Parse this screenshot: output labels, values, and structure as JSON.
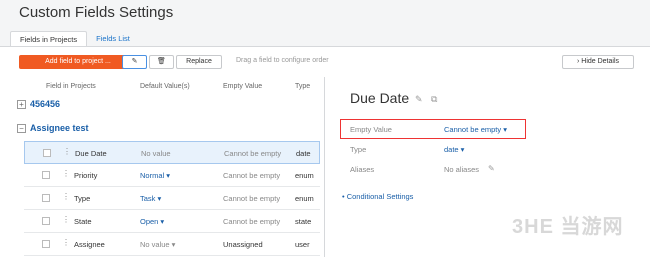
{
  "page": {
    "title": "Custom Fields Settings"
  },
  "tabs": [
    {
      "label": "Fields in Projects"
    },
    {
      "label": "Fields List"
    }
  ],
  "toolbar": {
    "add_label": "Add field to project ...",
    "replace_label": "Replace",
    "drag_hint": "Drag a field to configure order",
    "hide_label": "Hide Details",
    "pencil_icon": "✎",
    "trash_icon": "🗑"
  },
  "table": {
    "headers": {
      "field": "Field in Projects",
      "default": "Default Value(s)",
      "empty": "Empty Value",
      "type": "Type"
    },
    "groups": [
      {
        "name": "456456",
        "toggle": "+"
      },
      {
        "name": "Assignee test",
        "toggle": "−"
      }
    ],
    "rows": [
      {
        "name": "Due Date",
        "default": "No value",
        "empty": "Cannot be empty",
        "type": "date"
      },
      {
        "name": "Priority",
        "default": "Normal ▾",
        "empty": "Cannot be empty",
        "type": "enum"
      },
      {
        "name": "Type",
        "default": "Task ▾",
        "empty": "Cannot be empty",
        "type": "enum"
      },
      {
        "name": "State",
        "default": "Open ▾",
        "empty": "Cannot be empty",
        "type": "state"
      },
      {
        "name": "Assignee",
        "default": "No value ▾",
        "empty": "Unassigned",
        "type": "user"
      }
    ]
  },
  "details": {
    "title": "Due Date",
    "props": [
      {
        "label": "Empty Value",
        "value": "Cannot be empty ▾"
      },
      {
        "label": "Type",
        "value": "date ▾"
      },
      {
        "label": "Aliases",
        "value": "No aliases"
      }
    ],
    "conditional": "Conditional Settings",
    "edit_icon": "✎",
    "copy_icon": "⧉"
  },
  "watermark": "3HE 当游网"
}
